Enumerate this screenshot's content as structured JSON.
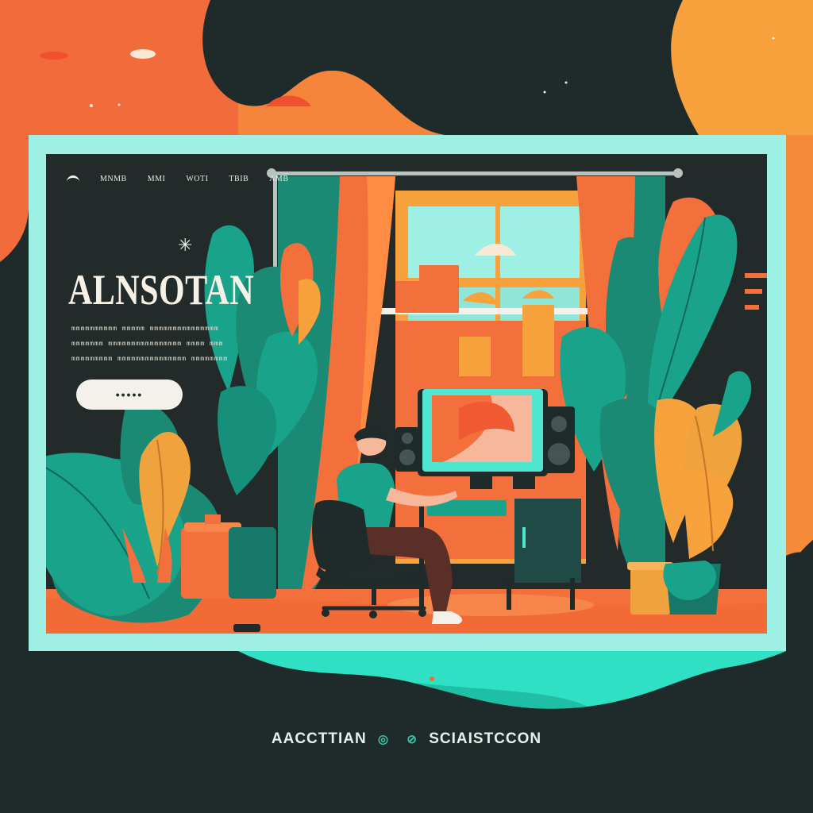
{
  "nav": {
    "items": [
      "MNMB",
      "MMI",
      "WOTI",
      "TBIB",
      "AMB"
    ]
  },
  "hero": {
    "title": "ALNSOTAN",
    "body_lines": [
      "mmmmmmmmmm mmmmm mmmmmmmmmmmmmmm",
      "mmmmmmm mmmmmmmmmmmmmmmm mmmm mmm",
      "mmmmmmmmm mmmmmmmmmmmmmmm mmmmmmmm"
    ],
    "button_label": "•••••"
  },
  "footer": {
    "left_text": "AACCTTIAN",
    "separator_left": "◎",
    "separator_right": "⊘",
    "right_text": "SCIAISTCCON"
  },
  "colors": {
    "background": "#1f2b2a",
    "orange": "#f36f3c",
    "amber": "#f7a23c",
    "teal": "#19a38a",
    "mint": "#9ff0e4",
    "cream": "#f6f1e6"
  },
  "icons": [
    "sparkle-icon",
    "logo-icon"
  ]
}
